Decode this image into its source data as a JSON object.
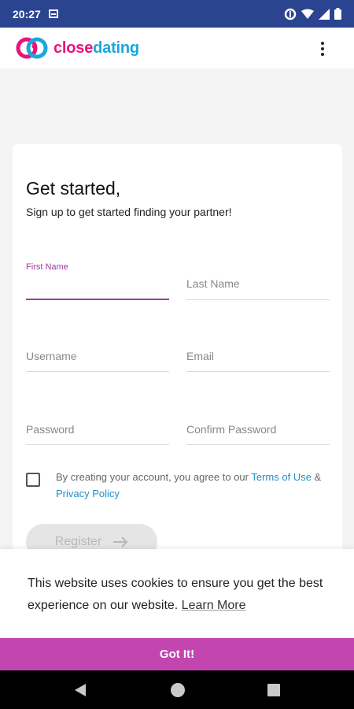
{
  "status_bar": {
    "time": "20:27",
    "icons": [
      "notification-icon",
      "data-saver-icon",
      "wifi-icon",
      "signal-icon",
      "battery-icon"
    ]
  },
  "app_bar": {
    "logo_close": "close",
    "logo_dating": "dating",
    "menu_icon": "more-vert-icon"
  },
  "form": {
    "title": "Get started,",
    "subtitle": "Sign up to get started finding your partner!",
    "fields": {
      "first_name": {
        "label": "First Name",
        "value": ""
      },
      "last_name": {
        "label": "Last Name",
        "value": ""
      },
      "username": {
        "label": "Username",
        "value": ""
      },
      "email": {
        "label": "Email",
        "value": ""
      },
      "password": {
        "label": "Password",
        "value": ""
      },
      "confirm_password": {
        "label": "Confirm Password",
        "value": ""
      }
    },
    "terms": {
      "prefix": "By creating your account, you agree to our ",
      "terms_link": "Terms of Use",
      "and": " & ",
      "privacy_link": "Privacy Policy",
      "checked": false
    },
    "register_label": "Register"
  },
  "cookie": {
    "text": "This website uses cookies to ensure you get the best experience on our website. ",
    "learn_more": "Learn More",
    "button": "Got It!"
  },
  "colors": {
    "status_bar": "#2a4490",
    "accent": "#9c3b9b",
    "link": "#1f8fc5",
    "got_it_bg": "#c245b0",
    "brand_pink": "#e9147a",
    "brand_blue": "#1aa7dc"
  }
}
